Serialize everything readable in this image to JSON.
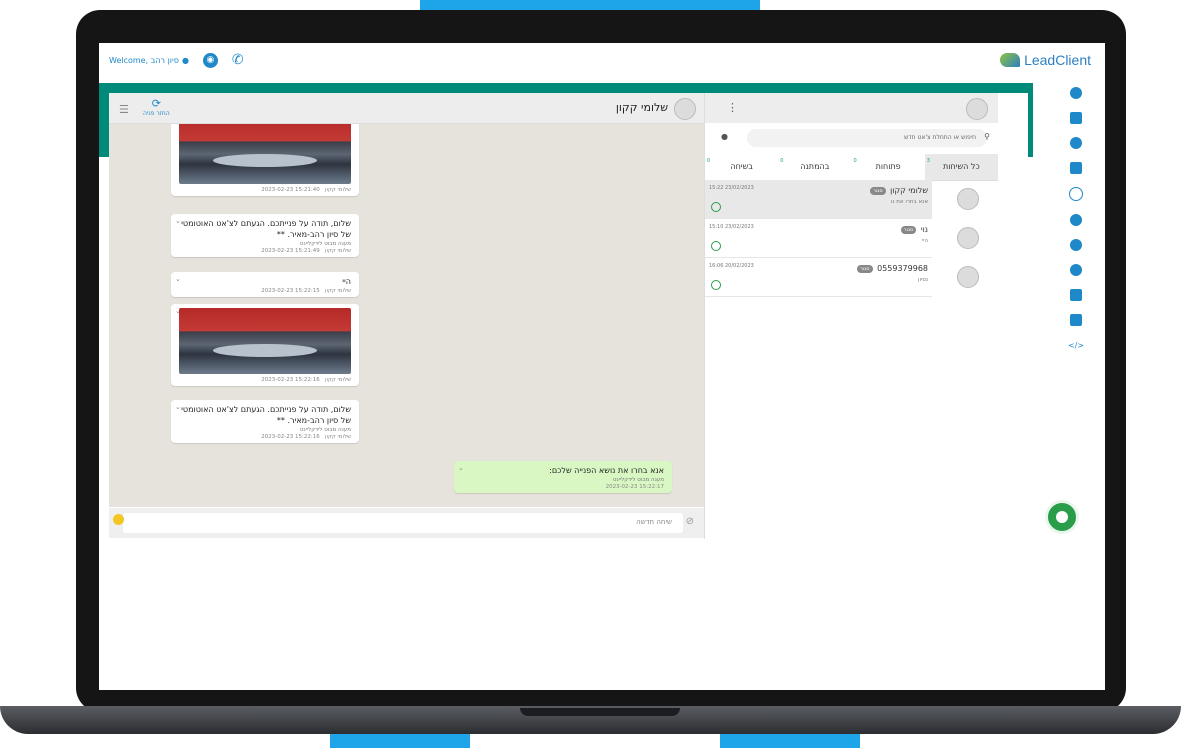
{
  "topbar": {
    "welcome_text": "Welcome, סיון רהב",
    "logo_text": "LeadClient",
    "user_icon": "user-icon",
    "globe_icon": "globe-icon",
    "phone_icon": "phone-icon"
  },
  "sidebar_icons": [
    "dashboard-icon",
    "tablet-icon",
    "chat-bubbles-icon",
    "document-icon",
    "whatsapp-icon",
    "user-circle-icon",
    "pie-chart-icon",
    "user-icon",
    "credit-card-icon",
    "envelope-icon",
    "code-icon"
  ],
  "conversation": {
    "contact_name": "שלומי קקון",
    "close_label": "החזר פניה",
    "messages": [
      {
        "type": "image",
        "meta": "15:21:40 2023-02-23",
        "sender": "שלומי קקון"
      },
      {
        "type": "text",
        "text": "שלום, תודה על פנייתכם. הגעתם לצ'אט האוטומטי של סיון רהב-מאיר. **",
        "sub": "מענה מבוט לידקליינט",
        "meta": "15:21:49 2023-02-23",
        "sender": "שלומי קקון"
      },
      {
        "type": "text",
        "text": "היי",
        "meta": "15:22:15 2023-02-23",
        "sender": "שלומי קקון"
      },
      {
        "type": "image",
        "meta": "15:22:16 2023-02-23",
        "sender": "שלומי קקון"
      },
      {
        "type": "text",
        "text": "שלום, תודה על פנייתכם. הגעתם לצ'אט האוטומטי של סיון רהב-מאיר. **",
        "sub": "מענה מבוט לידקליינט",
        "meta": "15:22:16 2023-02-23",
        "sender": "שלומי קקון"
      },
      {
        "type": "outgoing",
        "text": "אנא בחרו את נושא הפנייה שלכם:",
        "sub": "מענה מבוט לידקליינט",
        "meta": "15:22:17 2023-02-23"
      }
    ],
    "input_placeholder": "שיחה חדשה"
  },
  "chat_list": {
    "search_placeholder": "חיפוש או התחלת צ'אט חדש",
    "tabs": [
      {
        "label": "כל השיחות",
        "count": "3"
      },
      {
        "label": "פתוחות",
        "count": "0"
      },
      {
        "label": "בהמתנה",
        "count": "0"
      },
      {
        "label": "בשיחה",
        "count": "0"
      }
    ],
    "items": [
      {
        "name": "שלומי קקון",
        "tag": "סגור",
        "preview": "אנא בחרו את נו",
        "time": "15:22 23/02/2023"
      },
      {
        "name": "נוי",
        "tag": "סגור",
        "preview": "היי",
        "time": "15:10 23/02/2023"
      },
      {
        "name": "0559379968",
        "tag": "סגור",
        "preview": "נסיון",
        "time": "16:06 20/02/2023"
      }
    ]
  }
}
